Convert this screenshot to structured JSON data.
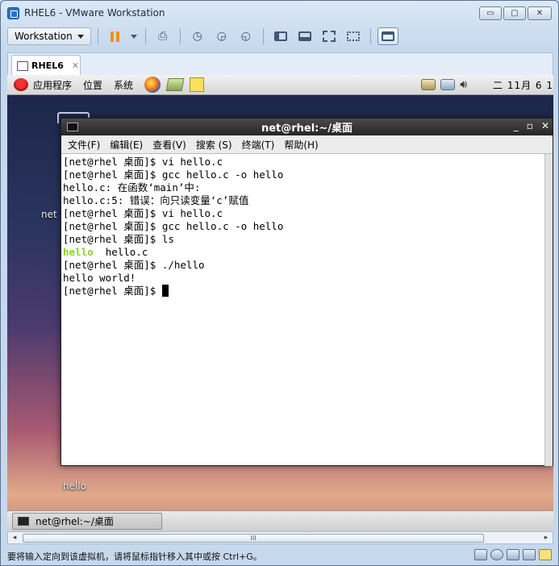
{
  "window": {
    "title": "RHEL6 - VMware Workstation",
    "controls": {
      "minimize": "▭",
      "maximize": "▢",
      "close": "✕"
    }
  },
  "toolbar": {
    "workstation_menu": "Workstation",
    "icons": [
      "pause-icon",
      "send-ctrl-alt-del-icon",
      "snapshot-take-icon",
      "snapshot-revert-icon",
      "snapshot-manager-icon",
      "view-console-icon",
      "view-thumbnail-icon",
      "fullscreen-icon",
      "unity-icon",
      "console-view-icon"
    ]
  },
  "tab": {
    "label": "RHEL6",
    "close": "✕"
  },
  "guest": {
    "panel": {
      "applications": "应用程序",
      "places": "位置",
      "system": "系统",
      "clock": "二 11月  6 1"
    },
    "desktop_labels": {
      "net": "net",
      "hello": "hello"
    },
    "terminal": {
      "title": "net@rhel:~/桌面",
      "menu": [
        "文件(F)",
        "编辑(E)",
        "查看(V)",
        "搜索 (S)",
        "终端(T)",
        "帮助(H)"
      ],
      "lines": [
        "[net@rhel 桌面]$ vi hello.c",
        "[net@rhel 桌面]$ gcc hello.c -o hello",
        "hello.c: 在函数‘main’中:",
        "hello.c:5: 错误：向只读变量‘c’赋值",
        "[net@rhel 桌面]$ vi hello.c",
        "[net@rhel 桌面]$ gcc hello.c -o hello",
        "[net@rhel 桌面]$ ls"
      ],
      "ls_exec": "hello",
      "ls_file": "  hello.c",
      "lines_after": [
        "[net@rhel 桌面]$ ./hello",
        "hello world!"
      ],
      "prompt": "[net@rhel 桌面]$ "
    },
    "taskbar": {
      "task_label": "net@rhel:~/桌面"
    }
  },
  "scrollbar": {
    "left": "◂",
    "right": "▸",
    "grip": "III"
  },
  "status": {
    "text": "要将输入定向到该虚拟机，请将鼠标指针移入其中或按 Ctrl+G。"
  },
  "colors": {
    "ls_executable": "#8ad22e",
    "accent": "#2a72c4"
  }
}
